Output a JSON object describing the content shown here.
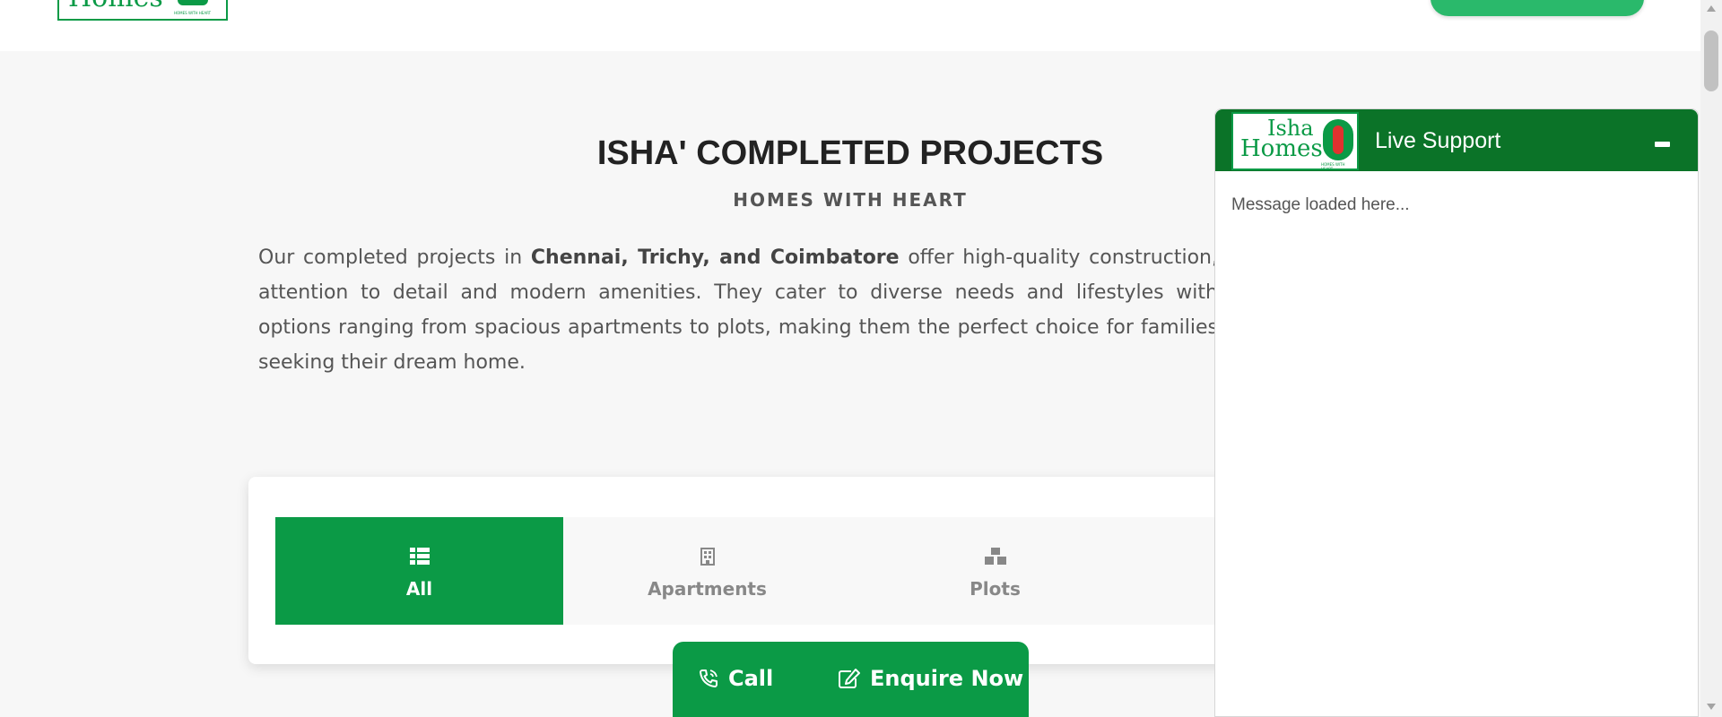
{
  "header": {
    "logo_text": "Homes",
    "logo_tagline": "HOMES WITH HEART"
  },
  "section": {
    "title": "ISHA' COMPLETED PROJECTS",
    "subtitle": "HOMES WITH HEART",
    "desc_part1": "Our completed projects in ",
    "desc_bold": "Chennai, Trichy, and Coimbatore",
    "desc_part2": " offer high-quality construction, attention to detail and modern amenities. They cater to diverse needs and lifestyles with options ranging from spacious apartments to plots, making them the perfect choice for families seeking their dream home."
  },
  "tabs": [
    {
      "label": "All",
      "icon": "list-icon",
      "active": true
    },
    {
      "label": "Apartments",
      "icon": "building-icon",
      "active": false
    },
    {
      "label": "Plots",
      "icon": "boxes-icon",
      "active": false
    }
  ],
  "callbar": {
    "call_label": "Call",
    "enquire_label": "Enquire Now"
  },
  "chat": {
    "logo_top": "Isha",
    "logo_bottom": "Homes",
    "logo_tagline": "HOMES WITH HEART",
    "title": "Live Support",
    "message": "Message loaded here..."
  },
  "colors": {
    "brand_green": "#0b9a46",
    "chat_header_green": "#0b7328",
    "cta_green": "#2ab96b"
  }
}
